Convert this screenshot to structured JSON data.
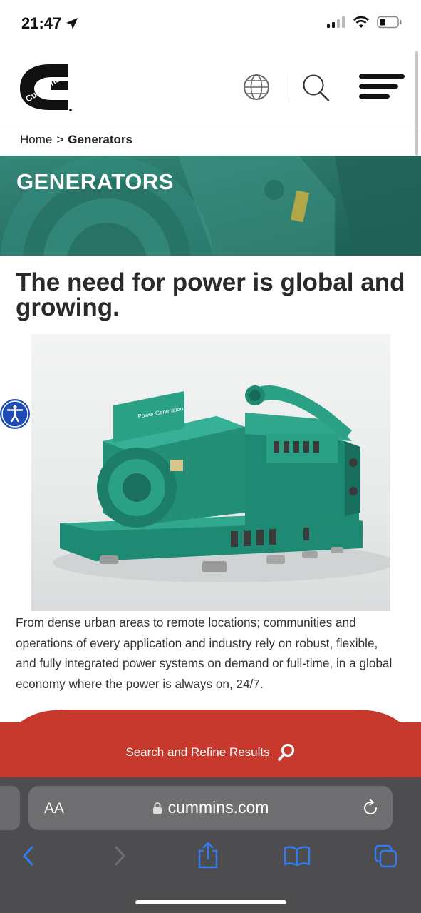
{
  "status_bar": {
    "time": "21:47"
  },
  "header": {
    "logo_text": "Cummins",
    "icons": [
      "globe-icon",
      "search-icon",
      "menu-icon"
    ]
  },
  "breadcrumb": {
    "home": "Home",
    "separator": ">",
    "current": "Generators"
  },
  "hero": {
    "title": "GENERATORS"
  },
  "main": {
    "headline": "The need for power is global and growing.",
    "product_badge": "Power Generation",
    "paragraph": "From dense urban areas to remote locations; communities and operations of every application and industry rely on robust, flexible, and fully integrated power systems on demand or full-time, in a global economy where the power is always on, 24/7."
  },
  "cta": {
    "label": "Search and Refine Results"
  },
  "safari": {
    "text_size_label": "AA",
    "url": "cummins.com",
    "toolbar": [
      "back-icon",
      "forward-icon",
      "share-icon",
      "bookmarks-icon",
      "tabs-icon"
    ]
  },
  "colors": {
    "brand_red": "#C6392C",
    "teal": "#2F8A7A",
    "safari_bar": "#4D4D4F",
    "safari_blue": "#2F7CF6"
  }
}
